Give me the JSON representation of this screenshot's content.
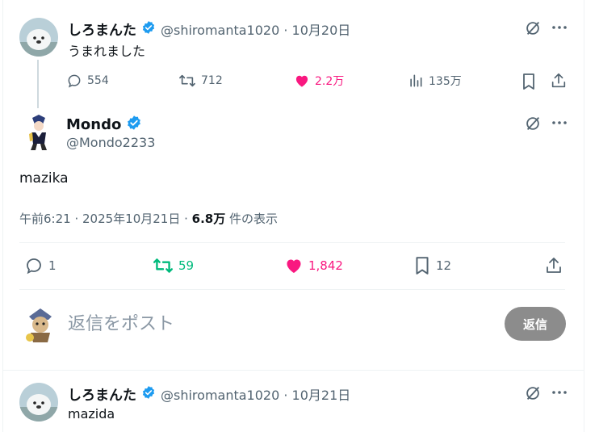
{
  "post1": {
    "display_name": "しろまんた",
    "handle_line": "@shiromanta1020 · 10月20日",
    "text": "うまれました",
    "replies": "554",
    "reposts": "712",
    "likes": "2.2万",
    "views": "135万"
  },
  "post2": {
    "display_name": "Mondo",
    "handle": "@Mondo2233",
    "text": "mazika",
    "time_date": "午前6:21 · 2025年10月21日 · ",
    "view_count": "6.8万",
    "view_suffix": " 件の表示",
    "replies": "1",
    "reposts": "59",
    "likes": "1,842",
    "bookmarks": "12"
  },
  "reply_box": {
    "placeholder": "返信をポスト",
    "button_label": "返信"
  },
  "post3": {
    "display_name": "しろまんた",
    "handle_line": "@shiromanta1020 · 10月21日",
    "text": "mazida"
  },
  "colors": {
    "accent": "#1d9bf0",
    "like": "#f91880",
    "repost": "#00ba7c",
    "muted": "#536471"
  }
}
